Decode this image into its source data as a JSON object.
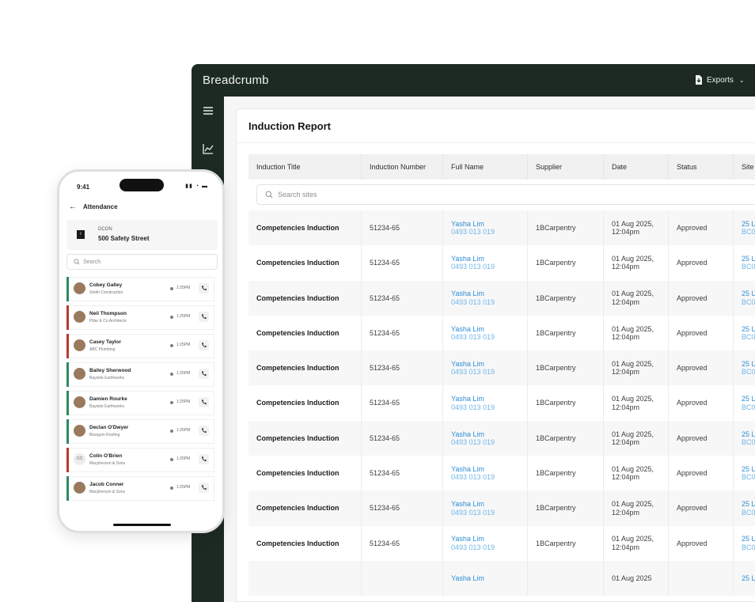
{
  "app": {
    "brand": "Breadcrumb",
    "exports_label": "Exports"
  },
  "report": {
    "title": "Induction Report",
    "columns": [
      "Induction Title",
      "Induction Number",
      "Full Name",
      "Supplier",
      "Date",
      "Status",
      "Site"
    ],
    "search_placeholder": "Search sites",
    "rows": [
      {
        "title": "Competencies Induction",
        "number": "51234-65",
        "name": "Yasha Lim",
        "phone": "0493 013 019",
        "supplier": "1BCarpentry",
        "date1": "01 Aug 2025,",
        "date2": "12:04pm",
        "status": "Approved",
        "site1": "25 L",
        "site2": "BC0"
      },
      {
        "title": "Competencies Induction",
        "number": "51234-65",
        "name": "Yasha Lim",
        "phone": "0493 013 019",
        "supplier": "1BCarpentry",
        "date1": "01 Aug 2025,",
        "date2": "12:04pm",
        "status": "Approved",
        "site1": "25 L",
        "site2": "BC0"
      },
      {
        "title": "Competencies Induction",
        "number": "51234-65",
        "name": "Yasha Lim",
        "phone": "0493 013 019",
        "supplier": "1BCarpentry",
        "date1": "01 Aug 2025,",
        "date2": "12:04pm",
        "status": "Approved",
        "site1": "25 L",
        "site2": "BC0"
      },
      {
        "title": "Competencies Induction",
        "number": "51234-65",
        "name": "Yasha Lim",
        "phone": "0493 013 019",
        "supplier": "1BCarpentry",
        "date1": "01 Aug 2025,",
        "date2": "12:04pm",
        "status": "Approved",
        "site1": "25 L",
        "site2": "BC0"
      },
      {
        "title": "Competencies Induction",
        "number": "51234-65",
        "name": "Yasha Lim",
        "phone": "0493 013 019",
        "supplier": "1BCarpentry",
        "date1": "01 Aug 2025,",
        "date2": "12:04pm",
        "status": "Approved",
        "site1": "25 L",
        "site2": "BC0"
      },
      {
        "title": "Competencies Induction",
        "number": "51234-65",
        "name": "Yasha Lim",
        "phone": "0493 013 019",
        "supplier": "1BCarpentry",
        "date1": "01 Aug 2025,",
        "date2": "12:04pm",
        "status": "Approved",
        "site1": "25 L",
        "site2": "BC0"
      },
      {
        "title": "Competencies Induction",
        "number": "51234-65",
        "name": "Yasha Lim",
        "phone": "0493 013 019",
        "supplier": "1BCarpentry",
        "date1": "01 Aug 2025,",
        "date2": "12:04pm",
        "status": "Approved",
        "site1": "25 L",
        "site2": "BC0"
      },
      {
        "title": "Competencies Induction",
        "number": "51234-65",
        "name": "Yasha Lim",
        "phone": "0493 013 019",
        "supplier": "1BCarpentry",
        "date1": "01 Aug 2025,",
        "date2": "12:04pm",
        "status": "Approved",
        "site1": "25 L",
        "site2": "BC0"
      },
      {
        "title": "Competencies Induction",
        "number": "51234-65",
        "name": "Yasha Lim",
        "phone": "0493 013 019",
        "supplier": "1BCarpentry",
        "date1": "01 Aug 2025,",
        "date2": "12:04pm",
        "status": "Approved",
        "site1": "25 L",
        "site2": "BC0"
      },
      {
        "title": "Competencies Induction",
        "number": "51234-65",
        "name": "Yasha Lim",
        "phone": "0493 013 019",
        "supplier": "1BCarpentry",
        "date1": "01 Aug 2025,",
        "date2": "12:04pm",
        "status": "Approved",
        "site1": "25 L",
        "site2": "BC0"
      },
      {
        "title": "",
        "number": "",
        "name": "Yasha Lim",
        "phone": "",
        "supplier": "",
        "date1": "01 Aug 2025",
        "date2": "",
        "status": "",
        "site1": "25 L",
        "site2": ""
      }
    ]
  },
  "phone": {
    "time": "9:41",
    "status_icons": "▮▮ ◔ ▬",
    "header_title": "Attendance",
    "site_sub": "DCON",
    "site_name": "500 Safety Street",
    "search_placeholder": "Search",
    "people": [
      {
        "name": "Cobey Galley",
        "company": "Smith Construction",
        "time": "1:25PM",
        "status_color": "#2f8a5e",
        "initials": ""
      },
      {
        "name": "Neil Thompson",
        "company": "Pillar & Co Architects",
        "time": "1:25PM",
        "status_color": "#b83a30",
        "initials": ""
      },
      {
        "name": "Casey Taylor",
        "company": "ABC Plumbing",
        "time": "1:25PM",
        "status_color": "#b83a30",
        "initials": ""
      },
      {
        "name": "Bailey Sherwood",
        "company": "Bayside Earthworks",
        "time": "1:25PM",
        "status_color": "#2f8a5e",
        "initials": ""
      },
      {
        "name": "Damien Rourke",
        "company": "Bayside Earthworks",
        "time": "1:25PM",
        "status_color": "#2f8a5e",
        "initials": ""
      },
      {
        "name": "Declan O'Dwyer",
        "company": "Bluegum Roofing",
        "time": "1:25PM",
        "status_color": "#2f8a5e",
        "initials": ""
      },
      {
        "name": "Colin O'Brien",
        "company": "Macpherson & Sons",
        "time": "1:25PM",
        "status_color": "#b83a30",
        "initials": "CO"
      },
      {
        "name": "Jacob Conner",
        "company": "Macpherson & Sons",
        "time": "1:25PM",
        "status_color": "#2f8a5e",
        "initials": ""
      }
    ]
  },
  "colors": {
    "sidebar": "#1d2a22",
    "link": "#2d8fd5",
    "present": "#2f8a5e",
    "absent": "#b83a30"
  }
}
